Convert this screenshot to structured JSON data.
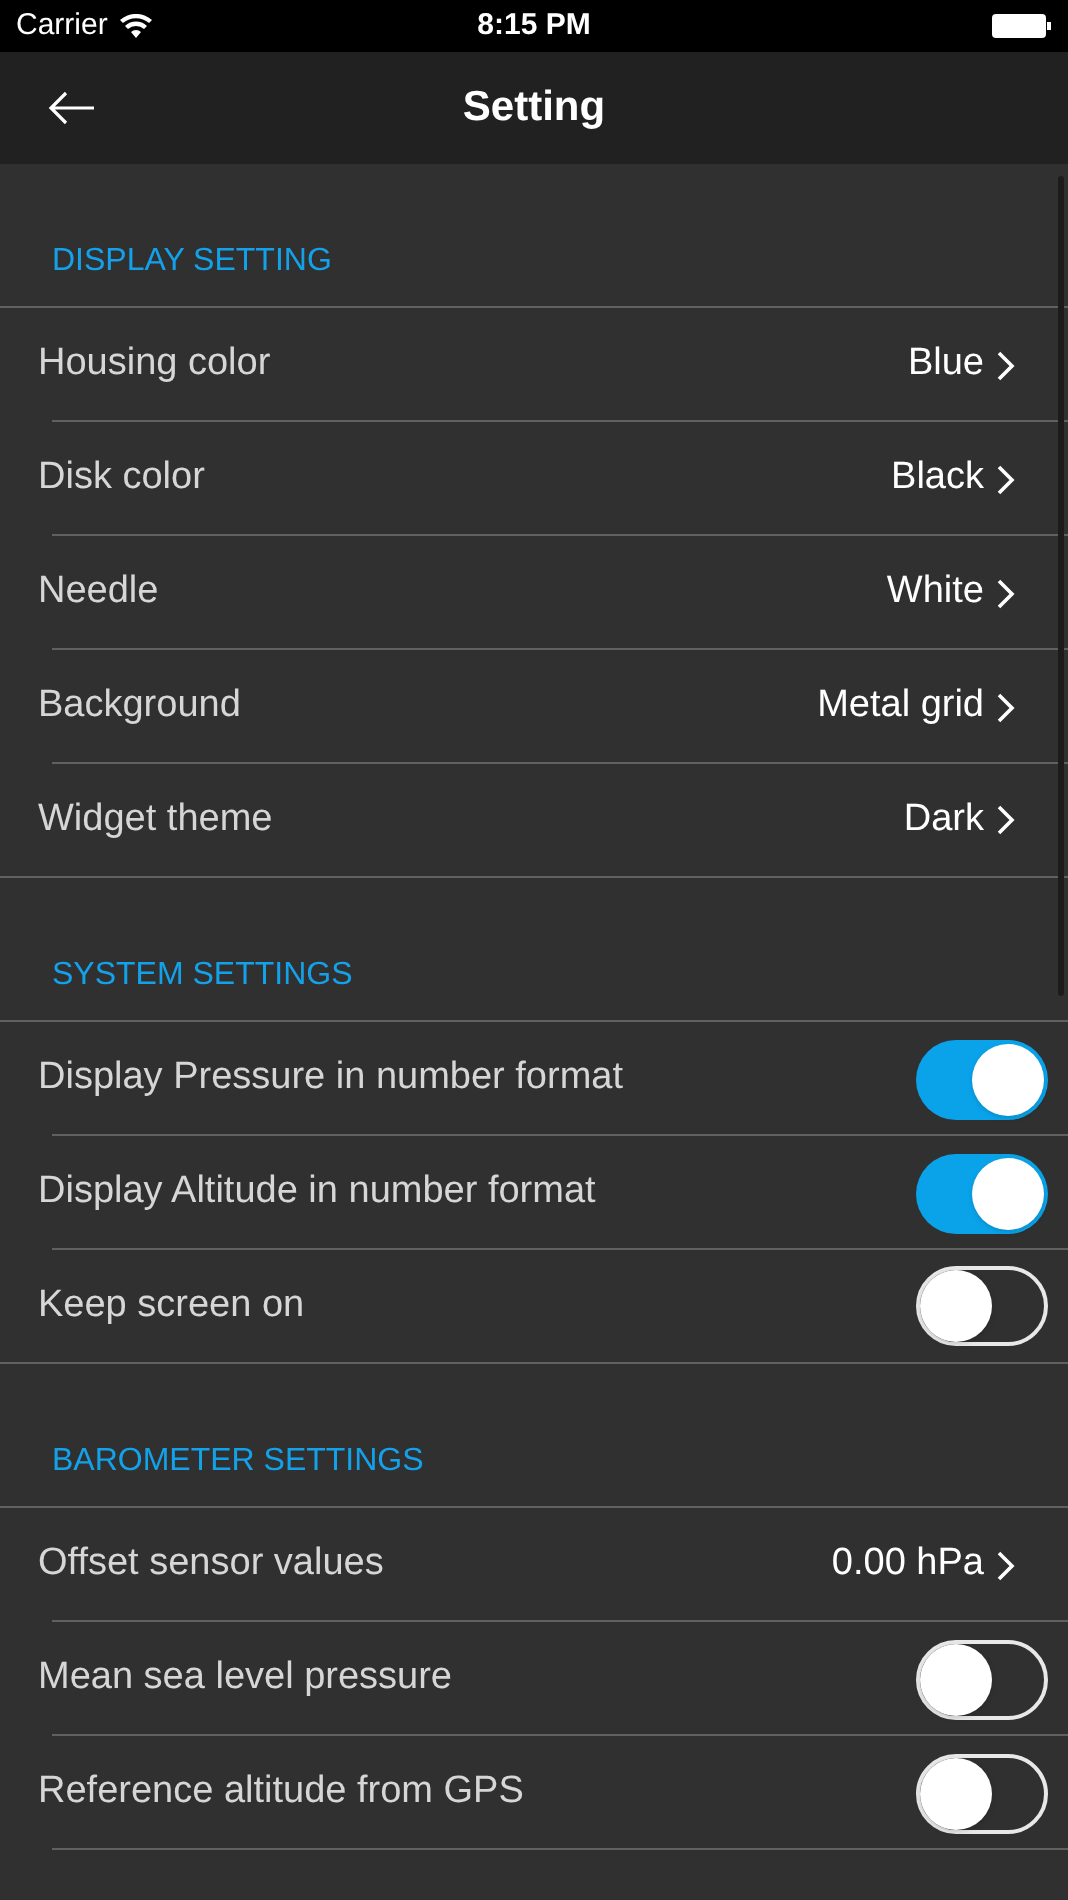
{
  "status_bar": {
    "carrier": "Carrier",
    "time": "8:15 PM"
  },
  "nav_bar": {
    "title": "Setting"
  },
  "sections": [
    {
      "title": "DISPLAY SETTING",
      "rows": [
        {
          "kind": "value",
          "label": "Housing color",
          "value": "Blue"
        },
        {
          "kind": "value",
          "label": "Disk color",
          "value": "Black"
        },
        {
          "kind": "value",
          "label": "Needle",
          "value": "White"
        },
        {
          "kind": "value",
          "label": "Background",
          "value": "Metal grid"
        },
        {
          "kind": "value",
          "label": "Widget theme",
          "value": "Dark"
        }
      ]
    },
    {
      "title": "SYSTEM SETTINGS",
      "rows": [
        {
          "kind": "toggle",
          "label": "Display Pressure in number format",
          "on": true
        },
        {
          "kind": "toggle",
          "label": "Display Altitude in number format",
          "on": true
        },
        {
          "kind": "toggle",
          "label": "Keep screen on",
          "on": false
        }
      ]
    },
    {
      "title": "BAROMETER SETTINGS",
      "rows": [
        {
          "kind": "value",
          "label": "Offset sensor values",
          "value": "0.00 hPa"
        },
        {
          "kind": "toggle",
          "label": "Mean sea level pressure",
          "on": false
        },
        {
          "kind": "toggle",
          "label": "Reference altitude from GPS",
          "on": false
        }
      ]
    }
  ]
}
